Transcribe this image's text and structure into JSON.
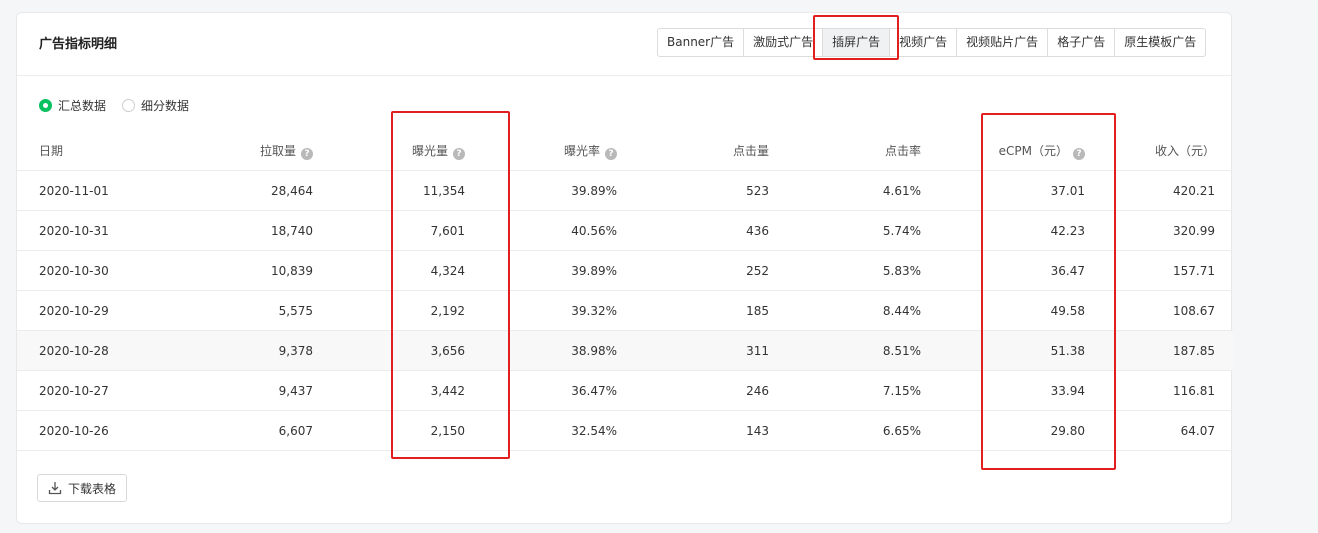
{
  "title": "广告指标明细",
  "tabs": [
    {
      "label": "Banner广告",
      "active": false
    },
    {
      "label": "激励式广告",
      "active": false
    },
    {
      "label": "插屏广告",
      "active": true
    },
    {
      "label": "视频广告",
      "active": false
    },
    {
      "label": "视频贴片广告",
      "active": false
    },
    {
      "label": "格子广告",
      "active": false
    },
    {
      "label": "原生模板广告",
      "active": false
    }
  ],
  "radios": [
    {
      "label": "汇总数据",
      "checked": true
    },
    {
      "label": "细分数据",
      "checked": false
    }
  ],
  "table": {
    "headers": [
      "日期",
      "拉取量",
      "曝光量",
      "曝光率",
      "点击量",
      "点击率",
      "eCPM（元）",
      "收入（元）"
    ],
    "help_icon_columns": [
      1,
      2,
      3,
      6
    ],
    "rows": [
      [
        "2020-11-01",
        "28,464",
        "11,354",
        "39.89%",
        "523",
        "4.61%",
        "37.01",
        "420.21"
      ],
      [
        "2020-10-31",
        "18,740",
        "7,601",
        "40.56%",
        "436",
        "5.74%",
        "42.23",
        "320.99"
      ],
      [
        "2020-10-30",
        "10,839",
        "4,324",
        "39.89%",
        "252",
        "5.83%",
        "36.47",
        "157.71"
      ],
      [
        "2020-10-29",
        "5,575",
        "2,192",
        "39.32%",
        "185",
        "8.44%",
        "49.58",
        "108.67"
      ],
      [
        "2020-10-28",
        "9,378",
        "3,656",
        "38.98%",
        "311",
        "8.51%",
        "51.38",
        "187.85"
      ],
      [
        "2020-10-27",
        "9,437",
        "3,442",
        "36.47%",
        "246",
        "7.15%",
        "33.94",
        "116.81"
      ],
      [
        "2020-10-26",
        "6,607",
        "2,150",
        "32.54%",
        "143",
        "6.65%",
        "29.80",
        "64.07"
      ]
    ],
    "highlighted_row": 4
  },
  "download_label": "下载表格",
  "help_icon": "question-circle-icon",
  "download_icon": "download-icon",
  "colors": {
    "accent_green": "#07c160",
    "annotation_red": "#e02020"
  }
}
